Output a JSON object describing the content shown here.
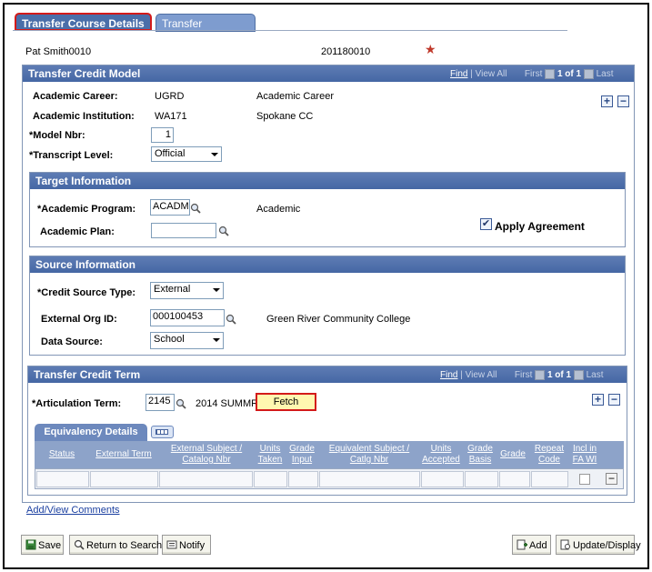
{
  "tabs": [
    {
      "label": "Transfer Course Details"
    },
    {
      "label": "Transfer Summary"
    }
  ],
  "header": {
    "name": "Pat Smith0010",
    "id": "201180010"
  },
  "model": {
    "title": "Transfer Credit Model",
    "nav": {
      "find": "Find",
      "sep": "|",
      "view_all": "View All",
      "first": "First",
      "count": "1 of 1",
      "last": "Last"
    },
    "academic_career_label": "Academic Career:",
    "academic_career_value": "UGRD",
    "academic_career_desc": "Academic Career",
    "academic_institution_label": "Academic Institution:",
    "academic_institution_value": "WA171",
    "academic_institution_desc": "Spokane CC",
    "model_nbr_label": "*Model Nbr:",
    "model_nbr_value": "1",
    "transcript_level_label": "*Transcript Level:",
    "transcript_level_value": "Official"
  },
  "target": {
    "title": "Target Information",
    "program_label": "*Academic Program:",
    "program_value": "ACADM",
    "program_desc": "Academic",
    "plan_label": "Academic Plan:",
    "plan_value": "",
    "apply_agreement_label": "Apply Agreement",
    "apply_agreement_checked": true
  },
  "source": {
    "title": "Source Information",
    "credit_source_label": "*Credit Source Type:",
    "credit_source_value": "External",
    "ext_org_label": "External Org ID:",
    "ext_org_value": "000100453",
    "ext_org_desc": "Green River Community College",
    "data_source_label": "Data Source:",
    "data_source_value": "School"
  },
  "term": {
    "title": "Transfer Credit Term",
    "nav": {
      "find": "Find",
      "sep": "|",
      "view_all": "View All",
      "first": "First",
      "count": "1 of 1",
      "last": "Last"
    },
    "articulation_label": "*Articulation Term:",
    "articulation_value": "2145",
    "articulation_desc": "2014 SUMMR",
    "fetch_label": "Fetch",
    "equiv_tab": "Equivalency Details",
    "columns": [
      "Status",
      "External Term",
      "External Subject / Catalog Nbr",
      "Units Taken",
      "Grade Input",
      "Equivalent Subject / Catlg Nbr",
      "Units Accepted",
      "Grade Basis",
      "Grade",
      "Repeat Code",
      "Incl in FA WI"
    ]
  },
  "links": {
    "add_view_comments": "Add/View Comments"
  },
  "toolbar": {
    "save": "Save",
    "return_to_search": "Return to Search",
    "notify": "Notify",
    "add": "Add",
    "update_display": "Update/Display"
  },
  "colors": {
    "highlight": "#d31a1a",
    "section_header": "#4567a4",
    "fetch_bg": "#fff7b0",
    "star": "#c0392b"
  }
}
